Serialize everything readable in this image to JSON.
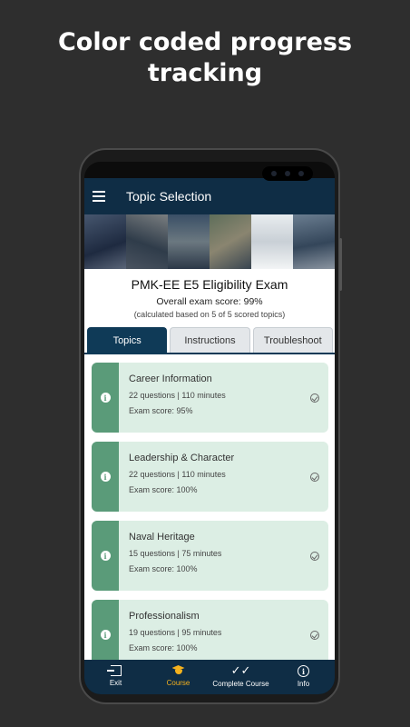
{
  "promo": {
    "line1": "Color coded progress",
    "line2": "tracking"
  },
  "appbar": {
    "title": "Topic Selection",
    "menu_icon": "hamburger-menu-icon"
  },
  "banner": {
    "colors": [
      "#2a3a55",
      "#4a5a6a",
      "#3d4f63",
      "#6a7a80",
      "#d8dde2",
      "#5a6e80"
    ]
  },
  "exam": {
    "title": "PMK-EE E5 Eligibility Exam",
    "score": "Overall exam score: 99%",
    "note": "(calculated based on 5 of 5 scored topics)"
  },
  "tabs": [
    {
      "label": "Topics",
      "active": true
    },
    {
      "label": "Instructions",
      "active": false
    },
    {
      "label": "Troubleshoot",
      "active": false
    }
  ],
  "topics": [
    {
      "title": "Career Information",
      "meta": "22 questions | 110 minutes",
      "score": "Exam score: 95%"
    },
    {
      "title": "Leadership & Character",
      "meta": "22 questions | 110 minutes",
      "score": "Exam score: 100%"
    },
    {
      "title": "Naval Heritage",
      "meta": "15 questions | 75 minutes",
      "score": "Exam score: 100%"
    },
    {
      "title": "Professionalism",
      "meta": "19 questions | 95 minutes",
      "score": "Exam score: 100%"
    }
  ],
  "bottom_nav": [
    {
      "label": "Exit",
      "icon": "exit-icon"
    },
    {
      "label": "Course",
      "icon": "graduation-cap-icon",
      "active": true
    },
    {
      "label": "Complete Course",
      "icon": "double-check-icon"
    },
    {
      "label": "Info",
      "icon": "info-icon"
    }
  ],
  "colors": {
    "appbar": "#0f2d45",
    "accent": "#5a9b79",
    "card": "#dceee4",
    "active_nav": "#f5b21e"
  }
}
